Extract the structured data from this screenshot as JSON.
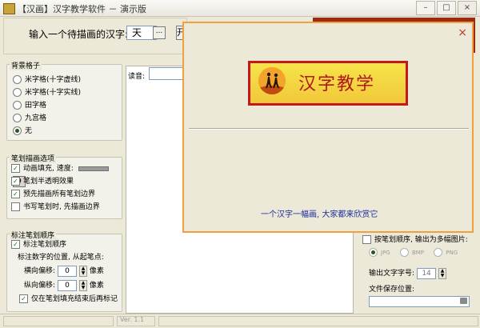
{
  "window": {
    "title": "【汉画】汉字教学软件 － 演示版",
    "minimize_icon": "minimize-icon",
    "maximize_icon": "maximize-icon",
    "close_icon": "close-icon",
    "minimize_glyph": "–",
    "maximize_glyph": "□",
    "close_glyph": "×"
  },
  "char_input": {
    "label": "输入一个待描画的汉字:",
    "value": "天",
    "browse_label": "...",
    "partial_button_label": "开"
  },
  "background_grid": {
    "title": "背景格子",
    "options": [
      {
        "label": "米字格(十字虚线)",
        "selected": false
      },
      {
        "label": "米字格(十字实线)",
        "selected": false
      },
      {
        "label": "田字格",
        "selected": false
      },
      {
        "label": "九宫格",
        "selected": false
      },
      {
        "label": "无",
        "selected": true
      }
    ]
  },
  "stroke_options": {
    "title": "笔划描画选项",
    "animate_label": "动画填充, 速度:",
    "animate_checked": true,
    "speed_value": "9",
    "translucent_label": "笔划半透明效果",
    "translucent_checked": true,
    "outline_label": "预先描画所有笔划边界",
    "outline_checked": true,
    "border_when_writing_label": "书写笔划时, 先描画边界",
    "border_when_writing_checked": false
  },
  "stroke_order": {
    "title": "标注笔划顺序",
    "mark_label": "标注笔划顺序",
    "mark_checked": true,
    "position_label": "标注数字的位置, 从起笔点:",
    "horizontal_label": "横向偏移:",
    "horizontal_value": "0",
    "vertical_label": "纵向偏移:",
    "vertical_value": "0",
    "unit": "像素",
    "after_fill_label": "仅在笔划填充结束后再标记",
    "after_fill_checked": true
  },
  "canvas": {
    "pronunciation_label": "读音:"
  },
  "export": {
    "by_order_label": "按笔划顺序, 输出为多幅图片:",
    "by_order_checked": false,
    "formats": [
      {
        "label": "JPG",
        "selected": true
      },
      {
        "label": "BMP",
        "selected": false
      },
      {
        "label": "PNG",
        "selected": false
      }
    ],
    "font_size_label": "输出文字字号:",
    "font_size_value": "14",
    "save_location_label": "文件保存位置:",
    "folder_icon": "folder-icon"
  },
  "status": {
    "version": "Ver. 1.1"
  },
  "about_dialog": {
    "close_glyph": "×",
    "banner_text": "汉字教学",
    "slogan": "一个汉字一幅画, 大家都来欣赏它"
  },
  "colors": {
    "dialog_border": "#f0a040",
    "banner_red": "#c2181e",
    "slogan_blue": "#1a2b9a"
  }
}
